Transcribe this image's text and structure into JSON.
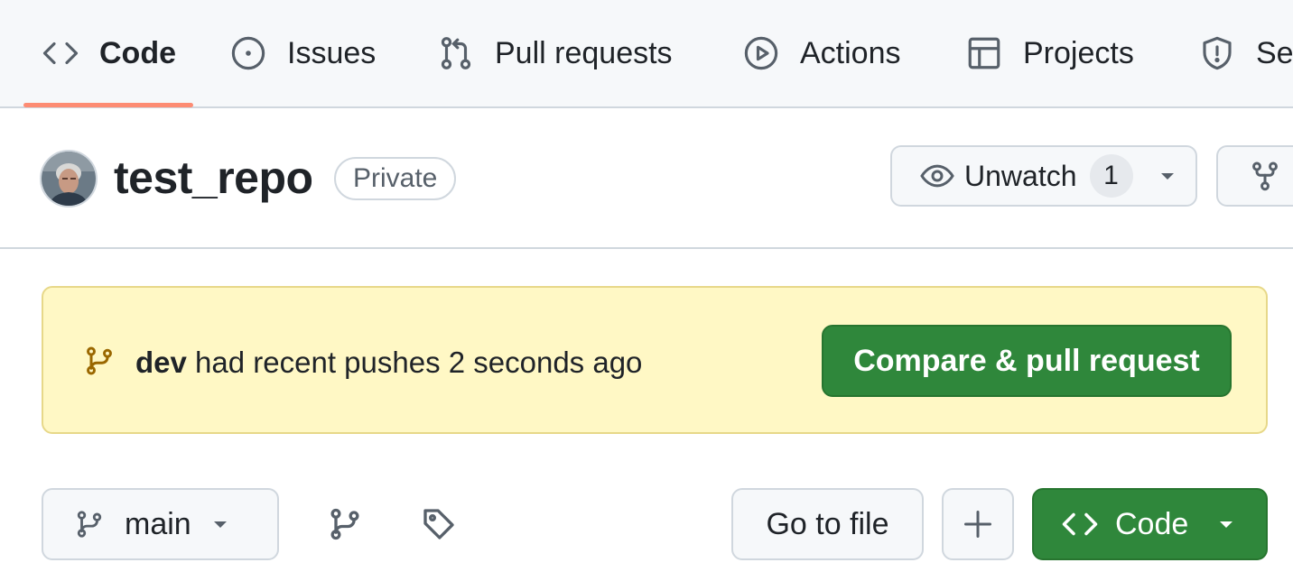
{
  "nav": {
    "tabs": [
      {
        "label": "Code",
        "icon": "code-icon",
        "active": true
      },
      {
        "label": "Issues",
        "icon": "issue-opened-icon",
        "active": false
      },
      {
        "label": "Pull requests",
        "icon": "git-pull-request-icon",
        "active": false
      },
      {
        "label": "Actions",
        "icon": "play-icon",
        "active": false
      },
      {
        "label": "Projects",
        "icon": "table-icon",
        "active": false
      },
      {
        "label": "Se",
        "icon": "shield-icon",
        "active": false
      }
    ],
    "active_underline_color": "#fd8c73"
  },
  "repo": {
    "name": "test_repo",
    "visibility": "Private",
    "watch": {
      "label": "Unwatch",
      "count": "1"
    }
  },
  "flash": {
    "branch": "dev",
    "message": " had recent pushes 2 seconds ago",
    "button": "Compare & pull request"
  },
  "filenav": {
    "branch": "main",
    "goto": "Go to file",
    "code_button": "Code"
  },
  "colors": {
    "green_button": "#2f873b",
    "flash_bg": "#fff8c5",
    "nav_bg": "#f6f8fa"
  }
}
